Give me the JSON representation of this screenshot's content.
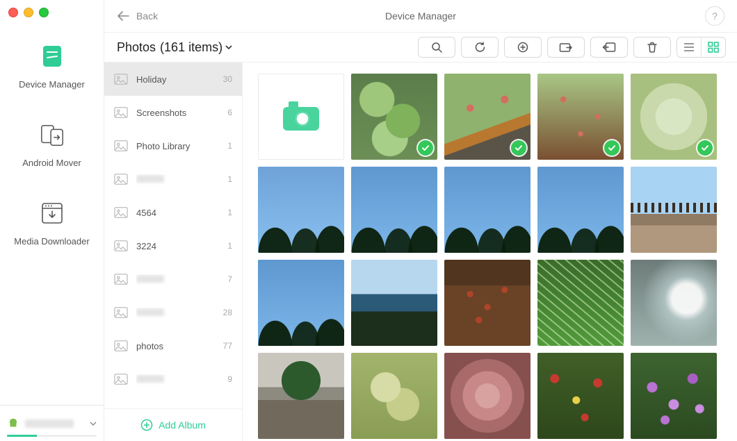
{
  "window": {
    "title": "Device Manager"
  },
  "topbar": {
    "back_label": "Back",
    "help_label": "?"
  },
  "rail": {
    "items": [
      {
        "id": "device-manager",
        "label": "Device Manager"
      },
      {
        "id": "android-mover",
        "label": "Android Mover"
      },
      {
        "id": "media-downloader",
        "label": "Media Downloader"
      }
    ],
    "device_status": {
      "fill_percent": 33
    }
  },
  "header": {
    "title_prefix": "Photos",
    "count_text": "(161 items)",
    "tools": {
      "search": "Search",
      "refresh": "Refresh",
      "add": "Add",
      "export": "Export",
      "send": "Send to device",
      "delete": "Delete"
    },
    "view": {
      "list": "List view",
      "grid": "Grid view",
      "active": "grid"
    }
  },
  "albums": {
    "add_label": "Add Album",
    "items": [
      {
        "name": "Holiday",
        "count": 30,
        "selected": true
      },
      {
        "name": "Screenshots",
        "count": 6
      },
      {
        "name": "Photo Library",
        "count": 1
      },
      {
        "name": "",
        "count": 1,
        "redacted": true
      },
      {
        "name": "4564",
        "count": 1
      },
      {
        "name": "3224",
        "count": 1
      },
      {
        "name": "",
        "count": 7,
        "redacted": true
      },
      {
        "name": "",
        "count": 28,
        "redacted": true
      },
      {
        "name": "photos",
        "count": 77
      },
      {
        "name": "",
        "count": 9,
        "redacted": true
      }
    ]
  },
  "grid": {
    "thumbs": [
      {
        "kind": "add"
      },
      {
        "cls": "th-succ1",
        "checked": true
      },
      {
        "cls": "th-succ2",
        "checked": true
      },
      {
        "cls": "th-succ3",
        "checked": true
      },
      {
        "cls": "th-succ4",
        "checked": true
      },
      {
        "cls": "th-palm1"
      },
      {
        "cls": "th-palm2"
      },
      {
        "cls": "th-palm3"
      },
      {
        "cls": "th-palm4"
      },
      {
        "cls": "th-beach"
      },
      {
        "cls": "th-palm5"
      },
      {
        "cls": "th-sea"
      },
      {
        "cls": "th-bush"
      },
      {
        "cls": "th-grass1"
      },
      {
        "cls": "th-sky"
      },
      {
        "cls": "th-bonsai"
      },
      {
        "cls": "th-succ5"
      },
      {
        "cls": "th-pinksucc"
      },
      {
        "cls": "th-flowers1"
      },
      {
        "cls": "th-flowers2"
      }
    ]
  },
  "colors": {
    "accent": "#2fcd95"
  }
}
